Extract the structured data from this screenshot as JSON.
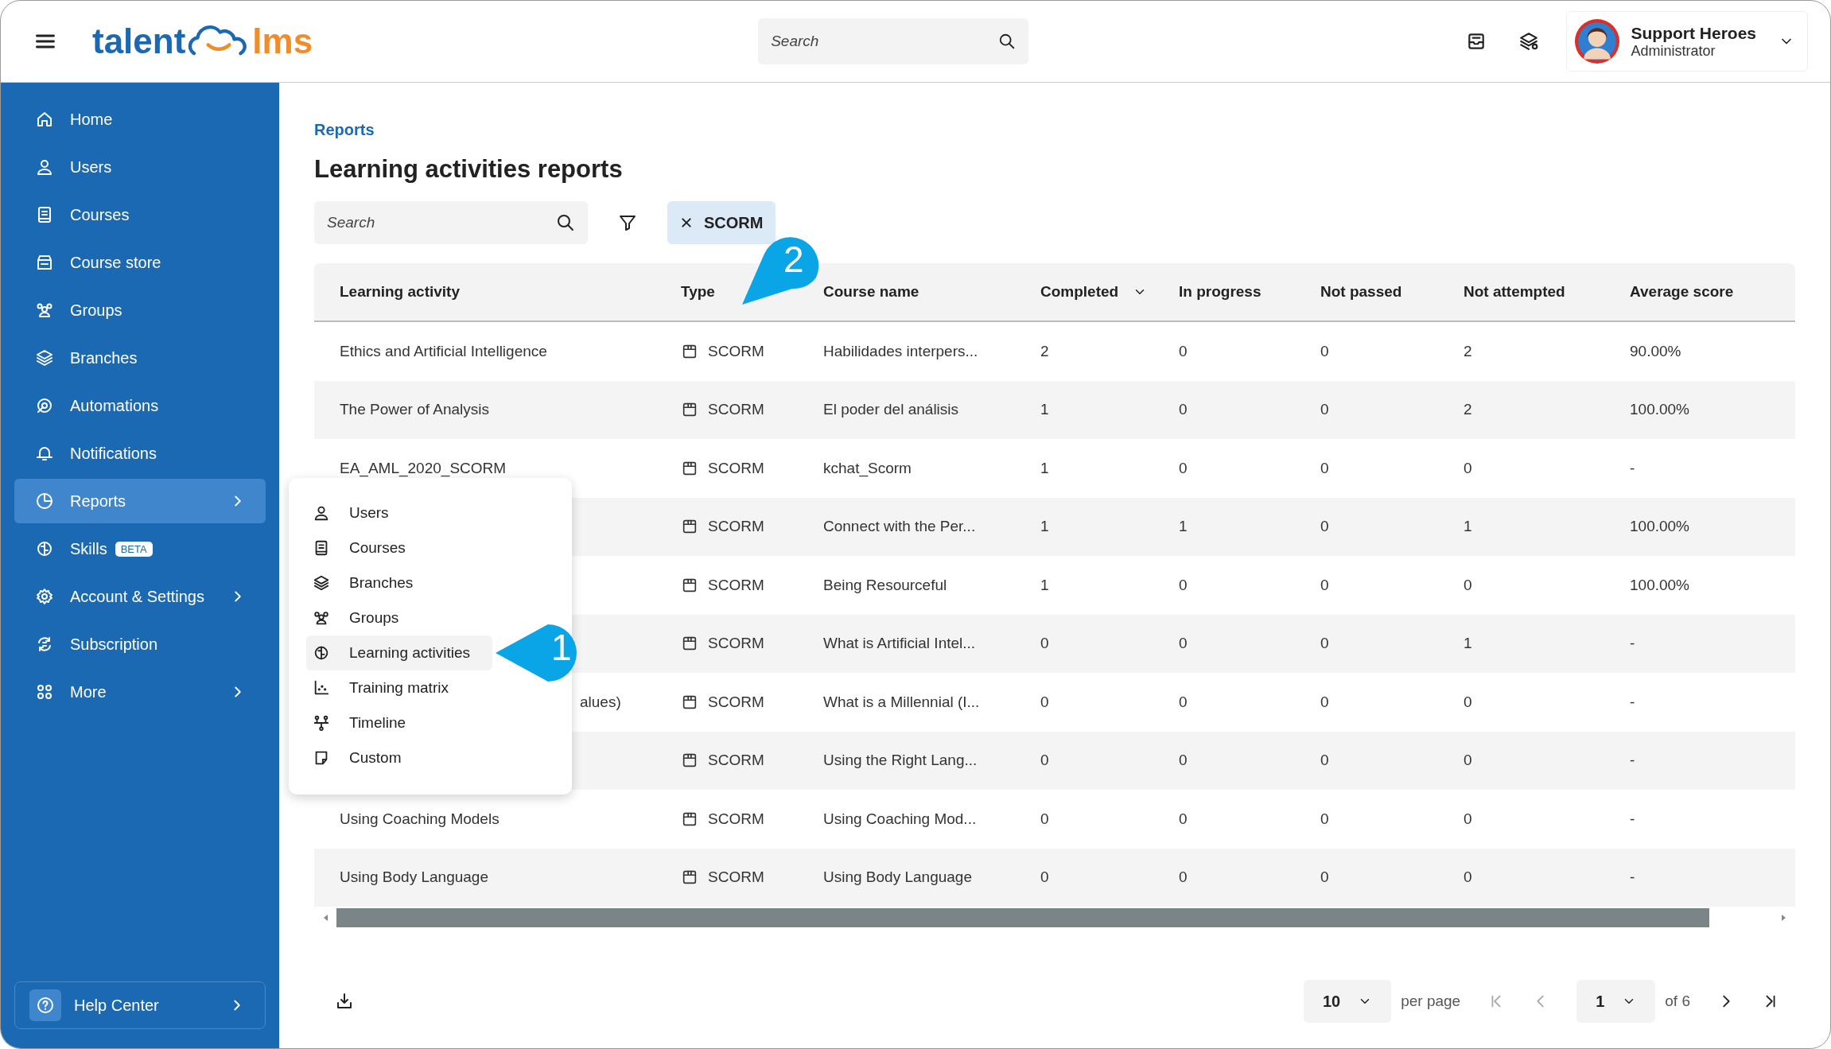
{
  "logo": {
    "part1": "talent",
    "part2": "lms"
  },
  "topbar": {
    "search": {
      "placeholder": "Search"
    },
    "user": {
      "name": "Support Heroes",
      "role": "Administrator"
    }
  },
  "sidebar": {
    "items": [
      {
        "label": "Home",
        "selected": false,
        "submenu": false
      },
      {
        "label": "Users",
        "selected": false,
        "submenu": false
      },
      {
        "label": "Courses",
        "selected": false,
        "submenu": false
      },
      {
        "label": "Course store",
        "selected": false,
        "submenu": false
      },
      {
        "label": "Groups",
        "selected": false,
        "submenu": false
      },
      {
        "label": "Branches",
        "selected": false,
        "submenu": false
      },
      {
        "label": "Automations",
        "selected": false,
        "submenu": false
      },
      {
        "label": "Notifications",
        "selected": false,
        "submenu": false
      },
      {
        "label": "Reports",
        "selected": true,
        "submenu": true
      },
      {
        "label": "Skills",
        "selected": false,
        "submenu": false,
        "badge": "BETA"
      },
      {
        "label": "Account & Settings",
        "selected": false,
        "submenu": true
      },
      {
        "label": "Subscription",
        "selected": false,
        "submenu": false
      },
      {
        "label": "More",
        "selected": false,
        "submenu": true
      }
    ],
    "help": {
      "label": "Help Center"
    }
  },
  "breadcrumb": "Reports",
  "title": "Learning activities reports",
  "filters": {
    "search": {
      "placeholder": "Search"
    },
    "chips": [
      {
        "label": "SCORM"
      }
    ]
  },
  "table": {
    "columns": [
      {
        "label": "Learning activity",
        "sorted": false
      },
      {
        "label": "Type",
        "sorted": false
      },
      {
        "label": "Course name",
        "sorted": false
      },
      {
        "label": "Completed",
        "sorted": true
      },
      {
        "label": "In progress",
        "sorted": false
      },
      {
        "label": "Not passed",
        "sorted": false
      },
      {
        "label": "Not attempted",
        "sorted": false
      },
      {
        "label": "Average score",
        "sorted": false
      }
    ],
    "rows": [
      {
        "learning_activity": "Ethics and Artificial Intelligence",
        "type": "SCORM",
        "course_name": "Habilidades interpers...",
        "completed": "2",
        "in_progress": "0",
        "not_passed": "0",
        "not_attempted": "2",
        "average_score": "90.00%"
      },
      {
        "learning_activity": "The Power of Analysis",
        "type": "SCORM",
        "course_name": "El poder del análisis",
        "completed": "1",
        "in_progress": "0",
        "not_passed": "0",
        "not_attempted": "2",
        "average_score": "100.00%"
      },
      {
        "learning_activity": "EA_AML_2020_SCORM",
        "type": "SCORM",
        "course_name": "kchat_Scorm",
        "completed": "1",
        "in_progress": "0",
        "not_passed": "0",
        "not_attempted": "0",
        "average_score": "-"
      },
      {
        "type": "SCORM",
        "course_name": "Connect with the Per...",
        "completed": "1",
        "in_progress": "1",
        "not_passed": "0",
        "not_attempted": "1",
        "average_score": "100.00%"
      },
      {
        "type": "SCORM",
        "course_name": "Being Resourceful",
        "completed": "1",
        "in_progress": "0",
        "not_passed": "0",
        "not_attempted": "0",
        "average_score": "100.00%"
      },
      {
        "type": "SCORM",
        "course_name": "What is Artificial Intel...",
        "completed": "0",
        "in_progress": "0",
        "not_passed": "0",
        "not_attempted": "1",
        "average_score": "-"
      },
      {
        "learning_activity": "alues)",
        "clipped": true,
        "type": "SCORM",
        "course_name": "What is a Millennial (I...",
        "completed": "0",
        "in_progress": "0",
        "not_passed": "0",
        "not_attempted": "0",
        "average_score": "-"
      },
      {
        "type": "SCORM",
        "course_name": "Using the Right Lang...",
        "completed": "0",
        "in_progress": "0",
        "not_passed": "0",
        "not_attempted": "0",
        "average_score": "-"
      },
      {
        "learning_activity": "Using Coaching Models",
        "type": "SCORM",
        "course_name": "Using Coaching Mod...",
        "completed": "0",
        "in_progress": "0",
        "not_passed": "0",
        "not_attempted": "0",
        "average_score": "-"
      },
      {
        "learning_activity": "Using Body Language",
        "type": "SCORM",
        "course_name": "Using Body Language",
        "completed": "0",
        "in_progress": "0",
        "not_passed": "0",
        "not_attempted": "0",
        "average_score": "-"
      }
    ]
  },
  "pagination": {
    "per_page": "10",
    "per_page_label": "per page",
    "page": "1",
    "total": "of 6"
  },
  "reports_menu": {
    "items": [
      {
        "label": "Users",
        "selected": false
      },
      {
        "label": "Courses",
        "selected": false
      },
      {
        "label": "Branches",
        "selected": false
      },
      {
        "label": "Groups",
        "selected": false
      },
      {
        "label": "Learning activities",
        "selected": true
      },
      {
        "label": "Training matrix",
        "selected": false
      },
      {
        "label": "Timeline",
        "selected": false
      },
      {
        "label": "Custom",
        "selected": false
      }
    ]
  },
  "callouts": [
    {
      "number": "1"
    },
    {
      "number": "2"
    }
  ]
}
